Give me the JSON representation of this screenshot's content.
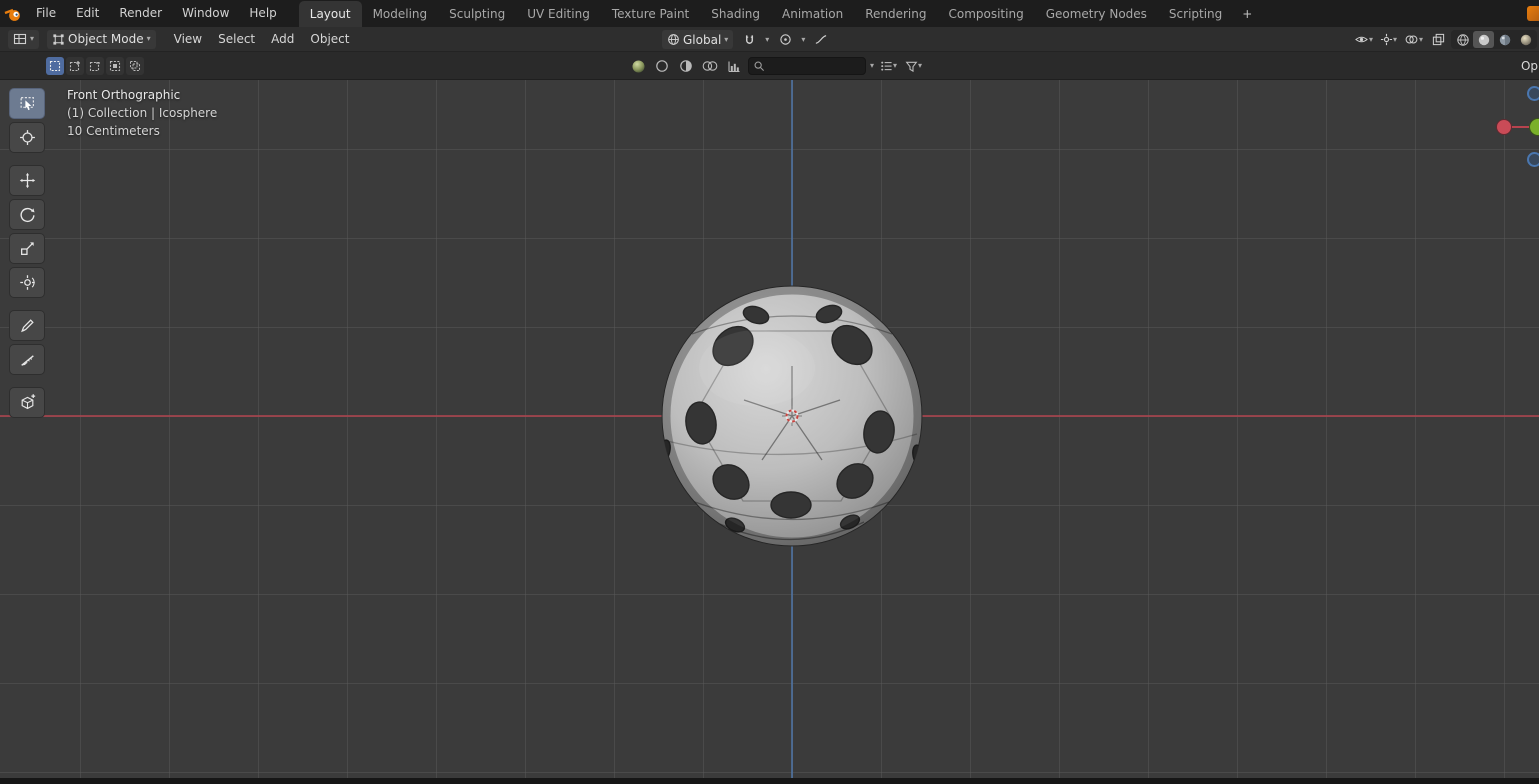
{
  "glyphs": {
    "chevron_down": "▾",
    "plus": "+"
  },
  "topbar": {
    "menus": [
      "File",
      "Edit",
      "Render",
      "Window",
      "Help"
    ],
    "tabs": [
      "Layout",
      "Modeling",
      "Sculpting",
      "UV Editing",
      "Texture Paint",
      "Shading",
      "Animation",
      "Rendering",
      "Compositing",
      "Geometry Nodes",
      "Scripting"
    ],
    "active_tab": "Layout"
  },
  "viewport_header": {
    "mode_label": "Object Mode",
    "menus": [
      "View",
      "Select",
      "Add",
      "Object"
    ],
    "orientation_label": "Global"
  },
  "tool_settings": {
    "options_label": "Op",
    "search_value": ""
  },
  "viewport": {
    "overlay_lines": [
      "Front Orthographic",
      "(1) Collection | Icosphere",
      "10 Centimeters"
    ],
    "object_name": "Icosphere"
  },
  "toolbar": {
    "tools": [
      "select-box",
      "cursor",
      "move",
      "rotate",
      "scale",
      "transform",
      "annotate",
      "measure",
      "add-cube"
    ],
    "active_tool": "select-box"
  },
  "colors": {
    "viewport_background": "#3b3b3b",
    "axis_x": "#a6444d",
    "axis_z": "#4f73a2",
    "active_tool_highlight": "#6d7b91",
    "topbar_background": "#1d1d1d",
    "header_background": "#2e2e2e",
    "selection_mode_active": "#4f6ca0"
  }
}
